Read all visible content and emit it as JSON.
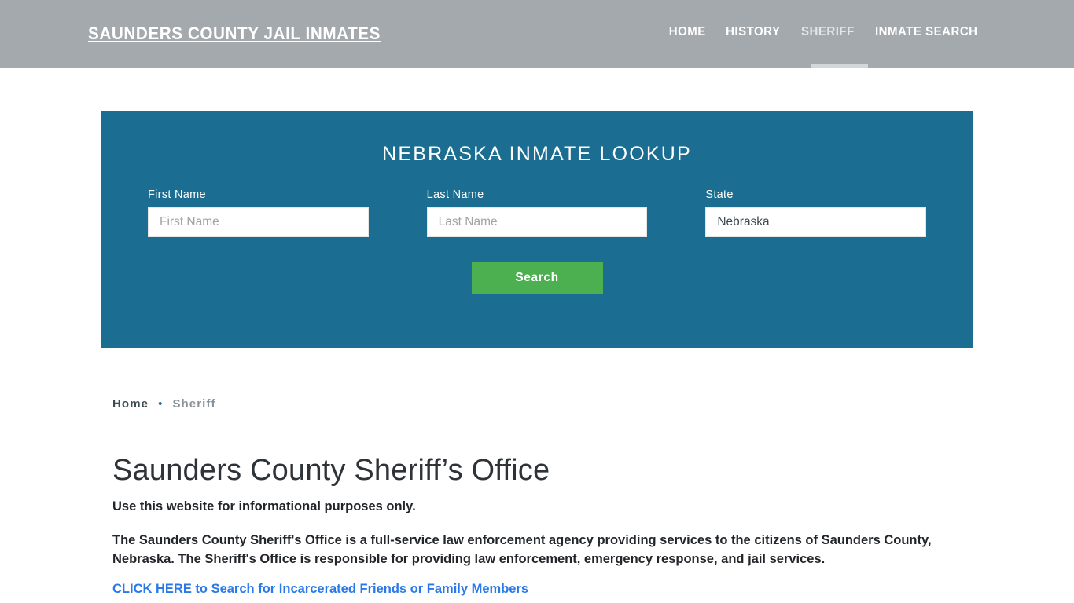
{
  "header": {
    "brand": "SAUNDERS COUNTY JAIL INMATES",
    "nav": [
      {
        "label": "HOME",
        "active": false
      },
      {
        "label": "HISTORY",
        "active": false
      },
      {
        "label": "SHERIFF",
        "active": true
      },
      {
        "label": "INMATE SEARCH",
        "active": false
      }
    ],
    "background_color": "#a4a9ad",
    "active_underline_color": "#d3d7da"
  },
  "lookup": {
    "title": "NEBRASKA INMATE LOOKUP",
    "panel_color": "#1b6e91",
    "fields": [
      {
        "label": "First Name",
        "placeholder": "First Name",
        "value": ""
      },
      {
        "label": "Last Name",
        "placeholder": "Last Name",
        "value": ""
      },
      {
        "label": "State",
        "placeholder": "State",
        "value": "Nebraska"
      }
    ],
    "search_label": "Search",
    "search_color": "#4caf50"
  },
  "breadcrumb": {
    "home": "Home",
    "separator": "•",
    "current": "Sheriff",
    "separator_color": "#1b6e91"
  },
  "main": {
    "title": "Saunders County Sheriff’s Office",
    "lede": "Use this website for informational purposes only.",
    "paragraph": "The Saunders County Sheriff's Office is a full-service law enforcement agency providing services to the citizens of Saunders County, Nebraska. The Sheriff's Office is responsible for providing law enforcement, emergency response, and jail services.",
    "cta_link": "CLICK HERE to Search for Incarcerated Friends or Family Members",
    "link_color": "#2979e8"
  }
}
